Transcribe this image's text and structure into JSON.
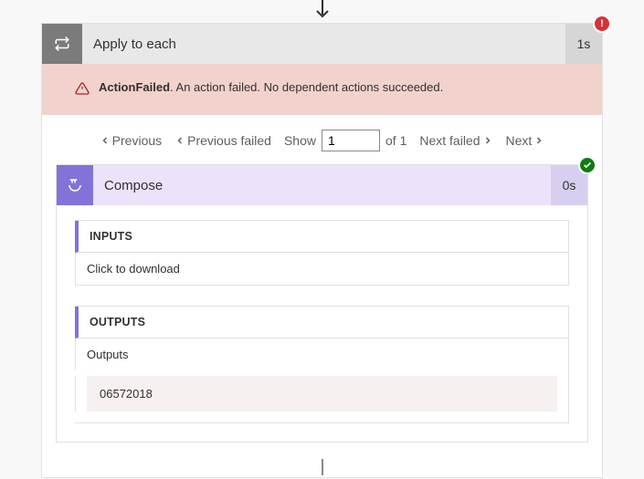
{
  "loop": {
    "title": "Apply to each",
    "duration": "1s",
    "error": {
      "code": "ActionFailed",
      "message": ". An action failed. No dependent actions succeeded."
    }
  },
  "pager": {
    "prev": "Previous",
    "prev_failed": "Previous failed",
    "show": "Show",
    "index": "1",
    "of_total": "of 1",
    "next_failed": "Next failed",
    "next": "Next"
  },
  "compose": {
    "title": "Compose",
    "duration": "0s",
    "inputs": {
      "label": "INPUTS",
      "link": "Click to download"
    },
    "outputs": {
      "label": "OUTPUTS",
      "field_label": "Outputs",
      "value": "06572018"
    }
  }
}
